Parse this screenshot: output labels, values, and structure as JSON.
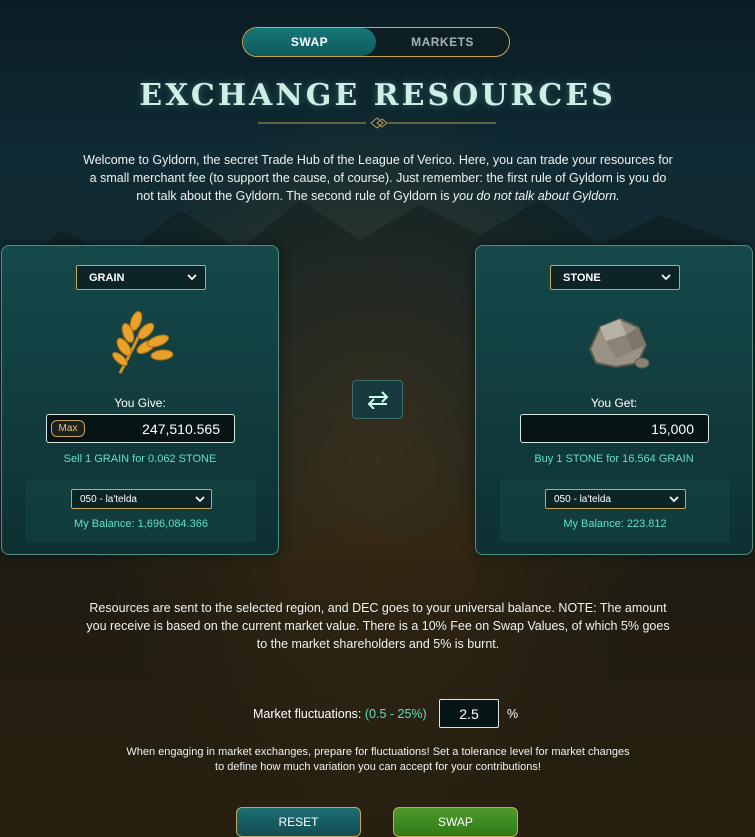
{
  "tabs": [
    {
      "label": "SWAP",
      "active": true
    },
    {
      "label": "MARKETS",
      "active": false
    }
  ],
  "title": "EXCHANGE RESOURCES",
  "intro": {
    "text": "Welcome to Gyldorn, the secret Trade Hub of the League of Verico. Here, you can trade your resources for a small merchant fee (to support the cause, of course). Just remember: the first rule of Gyldorn is you do not talk about the Gyldorn. The second rule of Gyldorn is ",
    "italic": "you do not talk about Gyldorn."
  },
  "give_panel": {
    "resource": "GRAIN",
    "label": "You Give:",
    "max_label": "Max",
    "amount": "247,510.565",
    "rate": "Sell 1 GRAIN for 0.062 STONE",
    "region": "050 - la'telda",
    "balance": "My Balance: 1,696,084.366",
    "icon": "grain-icon"
  },
  "get_panel": {
    "resource": "STONE",
    "label": "You Get:",
    "amount": "15,000",
    "rate": "Buy 1 STONE for 16.564 GRAIN",
    "region": "050 - la'telda",
    "balance": "My Balance: 223.812",
    "icon": "stone-icon"
  },
  "swap_direction_icon": "swap-arrows-icon",
  "notice": "Resources are sent to the selected region, and DEC goes to your universal balance. NOTE: The amount you receive is based on the current market value. There is a 10% Fee on Swap Values, of which 5% goes to the market shareholders and 5% is burnt.",
  "fluctuations": {
    "label": "Market fluctuations: ",
    "range": "(0.5 - 25%)",
    "value": "2.5",
    "unit": "%"
  },
  "tolerance_text": "When engaging in market exchanges, prepare for fluctuations! Set a tolerance level for market changes to define how much variation you can accept for your contributions!",
  "buttons": {
    "reset": "RESET",
    "swap": "SWAP"
  },
  "colors": {
    "accent_teal": "#5fe0c4",
    "gold_border": "#c9a55b",
    "swap_green": "#3f8a20"
  }
}
